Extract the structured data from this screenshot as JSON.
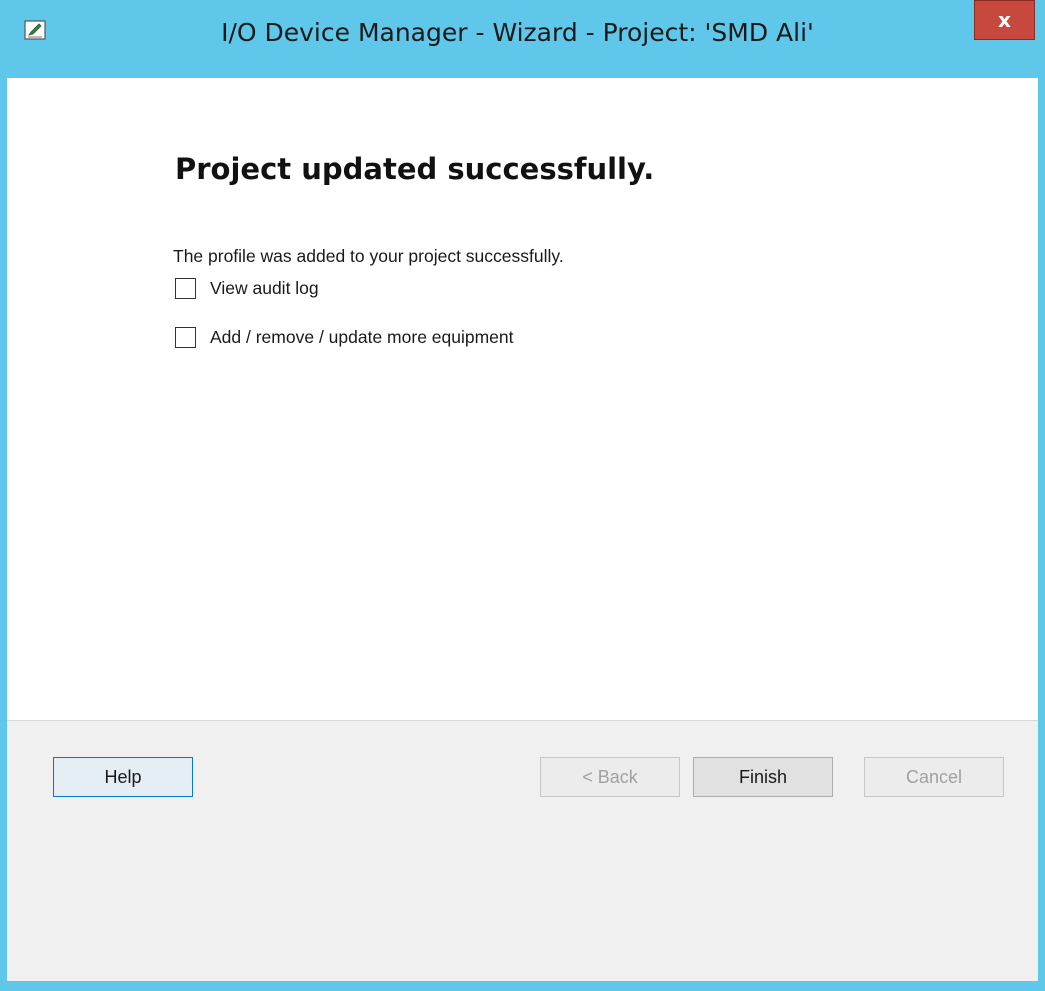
{
  "window": {
    "title": "I/O Device Manager - Wizard - Project: 'SMD Ali'",
    "close_label": "x",
    "app_icon": "edit-document-icon",
    "frame_color": "#5fc8ea",
    "close_color": "#c7483c"
  },
  "content": {
    "heading": "Project updated successfully.",
    "message": "The profile was added to your project successfully.",
    "options": [
      {
        "label": "View audit log",
        "checked": false
      },
      {
        "label": "Add / remove / update more equipment",
        "checked": false
      }
    ]
  },
  "footer": {
    "help_label": "Help",
    "back_label": "< Back",
    "finish_label": "Finish",
    "cancel_label": "Cancel",
    "back_enabled": false,
    "cancel_enabled": false
  }
}
